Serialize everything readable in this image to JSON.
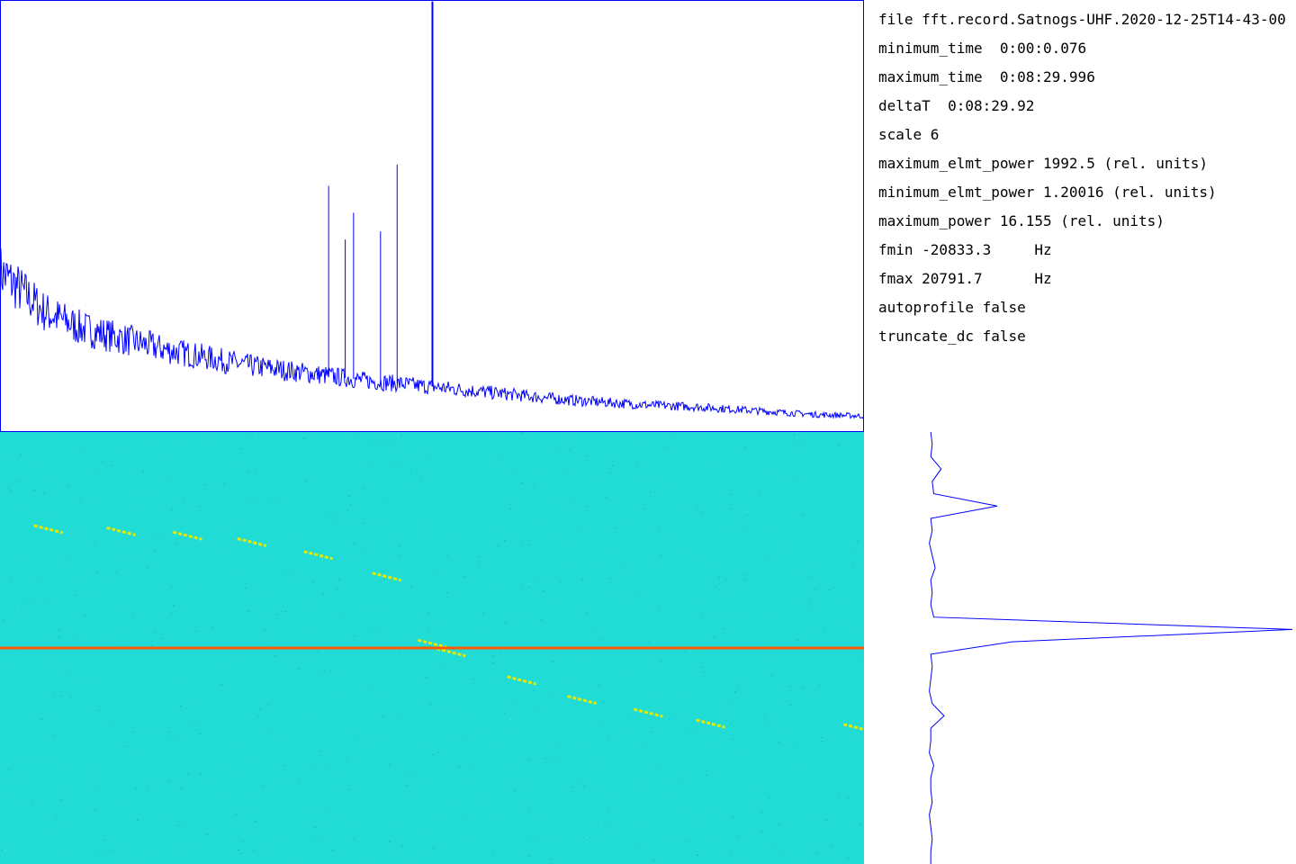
{
  "info": {
    "lines": [
      "file fft.record.Satnogs-UHF.2020-12-25T14-43-00",
      "minimum_time  0:00:0.076",
      "maximum_time  0:08:29.996",
      "deltaT  0:08:29.92",
      "scale 6",
      "maximum_elmt_power 1992.5 (rel. units)",
      "minimum_elmt_power 1.20016 (rel. units)",
      "maximum_power 16.155 (rel. units)",
      "fmin -20833.3     Hz",
      "fmax 20791.7      Hz",
      "autoprofile false",
      "truncate_dc false"
    ]
  },
  "colors": {
    "trace": "#0000ff",
    "waterfall_background": "#20dcd4",
    "dc_line": "#ff5a00",
    "signal": "#e8e800"
  },
  "chart_data": [
    {
      "type": "line",
      "name": "frequency-spectrum",
      "xlim": [
        -20833.3,
        20791.7
      ],
      "ylim": [
        0,
        16.155
      ],
      "x": [
        -20833.3,
        -18700,
        -17000,
        -15000,
        -13000,
        -11000,
        -9000,
        -7000,
        -5000,
        -3000,
        -1500,
        -300,
        0,
        500,
        2500,
        4500,
        6500,
        8500,
        10500,
        12500,
        14500,
        16500,
        18500,
        20791.7
      ],
      "y": [
        6.0,
        4.5,
        3.9,
        3.5,
        3.1,
        2.8,
        2.5,
        2.3,
        2.1,
        1.9,
        1.8,
        1.7,
        1.7,
        1.65,
        1.5,
        1.35,
        1.2,
        1.1,
        1.0,
        0.95,
        0.85,
        0.75,
        0.65,
        0.6
      ],
      "peaks": [
        {
          "x": 0,
          "y": 16.1
        },
        {
          "x": -1700,
          "y": 10.0
        },
        {
          "x": -5000,
          "y": 9.2
        },
        {
          "x": -3800,
          "y": 8.2
        },
        {
          "x": -2500,
          "y": 7.5
        },
        {
          "x": -4200,
          "y": 7.2
        }
      ]
    },
    {
      "type": "heatmap",
      "name": "waterfall",
      "xlim": [
        -20833.3,
        20791.7
      ],
      "ylim": [
        "0:00:0.076",
        "0:08:29.996"
      ],
      "dc_line_fraction": 0.5,
      "signal_track": {
        "x": [
          -18500,
          -15000,
          -11800,
          -8700,
          -5500,
          -2200,
          0,
          900,
          4300,
          7200,
          10400,
          13400,
          20500
        ],
        "t_fraction": [
          0.225,
          0.23,
          0.24,
          0.255,
          0.285,
          0.335,
          0.49,
          0.51,
          0.575,
          0.62,
          0.65,
          0.675,
          0.685
        ]
      }
    },
    {
      "type": "line",
      "name": "time-profile",
      "values": [
        0.5,
        0.6,
        0.5,
        1.2,
        0.6,
        0.7,
        5.0,
        0.5,
        0.6,
        0.4,
        0.6,
        0.8,
        0.5,
        0.6,
        0.5,
        0.7,
        25.0,
        6.0,
        0.5,
        0.6,
        0.5,
        0.4,
        0.6,
        1.4,
        0.5,
        0.5,
        0.4,
        0.7,
        0.5,
        0.5,
        0.6,
        0.4,
        0.5,
        0.6,
        0.5,
        0.5
      ]
    }
  ]
}
